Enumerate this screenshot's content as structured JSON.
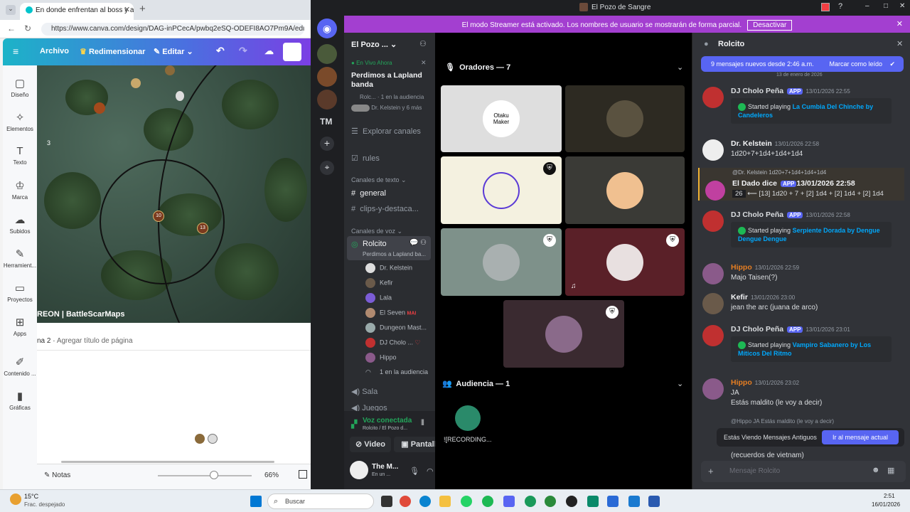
{
  "browser": {
    "tab_title": "En donde enfrentan al boss y al cr",
    "url": "https://www.canva.com/design/DAG-inPCecA/pwbq2eSQ-ODEFI8AO7Pm9A/edit",
    "canva_toolbar": {
      "archivo": "Archivo",
      "redimensionar": "Redimensionar",
      "editar": "Editar"
    },
    "rail": [
      "Diseño",
      "Elementos",
      "Texto",
      "Marca",
      "Subidos",
      "Herramient...",
      "Proyectos",
      "Apps",
      "Contenido ...",
      "Gráficas"
    ],
    "map_watermark": "REON | BattleScarMaps",
    "map_num": "3",
    "token_1": "10",
    "token_2": "13",
    "page2_label": "na 2 · ",
    "page2_title": "Agregar título de página",
    "notas": "Notas",
    "zoom": "66%",
    "zoom_fraction": 0.6
  },
  "discord": {
    "window_title": "El Pozo de Sangre",
    "streamer_msg": "El modo Streamer está activado. Los nombres de usuario se mostrarán de forma parcial.",
    "streamer_btn": "Desactivar",
    "server_tm": "TM",
    "server_name": "El Pozo ...",
    "live": {
      "badge": "En Vivo Ahora",
      "title": "Perdimos a Lapland banda",
      "sub": "Rolc... · 1 en la audiencia",
      "people": "Dr. Kelstein y 6 más"
    },
    "explore": "Explorar canales",
    "rules": "rules",
    "text_channels": "Canales de texto",
    "ch_general": "general",
    "ch_clips": "clips-y-destaca...",
    "voice_channels": "Canales de voz",
    "voice_ch": "Rolcito",
    "voice_ch_sub": "Perdimos a Lapland ba...",
    "voice_users": [
      "Dr. Kelstein",
      "Kefir",
      "Lala",
      "El Seven",
      "Dungeon Mast...",
      "DJ Cholo ...",
      "Hippo"
    ],
    "el_seven_tag": "MAI",
    "audience_count": "1 en la audiencia",
    "ch_sala": "Sala",
    "ch_juegos": "Juegos",
    "voice_connected": "Voz conectada",
    "voice_loc": "Rolcito / El Pozo d...",
    "video_btn": "Video",
    "screen_btn": "Pantall",
    "user_name": "The M...",
    "user_status": "En un ...",
    "speakers_header": "Oradores — 7",
    "audience_header": "Audiencia — 1",
    "tile_logo": "Otaku\nMaker",
    "audience_name": "![RECORDING...",
    "chat_title": "Rolcito",
    "new_msgs": "9 mensajes nuevos desde 2:46 a.m.",
    "mark_read": "Marcar como leído",
    "date_div": "13 de enero de 2026",
    "app_tag": "APP",
    "started_playing": "Started playing",
    "messages": [
      {
        "name": "DJ Cholo Peña",
        "ts": "13/01/2026 22:55",
        "song": "La Cumbia Del Chinche by Candeleros"
      },
      {
        "name": "Dr. Kelstein",
        "ts": "13/01/2026 22:58",
        "text": "1d20+7+1d4+1d4+1d4"
      },
      {
        "name": "El Dado dice",
        "ts": "13/01/2026 22:58",
        "reply": "@Dr. Kelstein 1d20+7+1d4+1d4+1d4",
        "total": "26",
        "text": "⟵ [13] 1d20 + 7 + [2] 1d4 + [2] 1d4 + [2] 1d4"
      },
      {
        "name": "DJ Cholo Peña",
        "ts": "13/01/2026 22:58",
        "song": "Serpiente Dorada by Dengue Dengue Dengue"
      },
      {
        "name": "Hippo",
        "ts": "13/01/2026 22:59",
        "text": "Majo Taisen(?)"
      },
      {
        "name": "Kefir",
        "ts": "13/01/2026 23:00",
        "text": "jean the arc (juana de arco)"
      },
      {
        "name": "DJ Cholo Peña",
        "ts": "13/01/2026 23:01",
        "song": "Vampiro Sabanero by Los Míticos Del Ritmo"
      },
      {
        "name": "Hippo",
        "ts": "13/01/2026 23:02",
        "text": "JA",
        "text2": "Estás maldito (le voy a decir)"
      }
    ],
    "reply_peek": "@Hippo JA Estás maldito (le voy a decir)",
    "peek_text": "(recuerdos de vietnam)",
    "old_msgs": "Estás Viendo Mensajes Antiguos",
    "jump_btn": "Ir al mensaje actual",
    "chat_placeholder": "Mensaje Rolcito",
    "colors": {
      "accent": "#5865f2",
      "streamer": "#a33fd0",
      "hippo": "#e67e22",
      "link": "#00a8fc"
    }
  },
  "taskbar": {
    "weather_temp": "15°C",
    "weather_desc": "Frac. despejado",
    "search": "Buscar",
    "time": "2:51",
    "date": "16/01/2026"
  }
}
